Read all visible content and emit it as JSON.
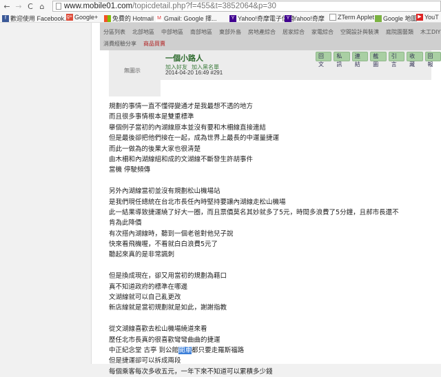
{
  "browser": {
    "url_host": "www.mobile01.com",
    "url_path": "/topicdetail.php?f=455&t=3852064&p=30",
    "bookmarks": [
      "歡迎使用 Facebook...",
      "Google+",
      "免費的 Hotmail",
      "Gmail: Google 擇...",
      "Yahoo!奇摩電子信箱",
      "Yahoo!奇摩",
      "ZTerm Applet",
      "Google 地圖",
      "YouT"
    ]
  },
  "nav": {
    "row1": [
      "分區列表",
      "北部地區",
      "中部地區",
      "南部地區",
      "東部外島",
      "房地產綜合",
      "居家綜合",
      "家電綜合",
      "空間設計與裝潢",
      "庭院園藝類",
      "木工DIY"
    ],
    "row2": [
      "消費經驗分享",
      "商品買賣"
    ]
  },
  "post": {
    "no_image": "無圖示",
    "author": "一個小路人",
    "add_friend": "加入好友",
    "add_block": "加入黑名單",
    "datetime": "2014-04-20 16:49",
    "number": "#291",
    "actions": [
      "回文",
      "私訊",
      "連結",
      "截圖",
      "引言",
      "收藏",
      "回報"
    ],
    "lines": [
      "規劃的事情一直不懂得變通才是我最想不透的地方",
      "而且很多事情根本是雙重標準",
      "舉個例子當初的內湖線原本並沒有要和木柵線直接連結",
      "但是最後卻把他們接在一起，成為世界上最長的中運量捷運",
      "而此一做為的後果大家也很清楚",
      "由木柵和內湖線組和成的文湖線不斷發生許胡事件",
      "當機 停駛頻傳",
      "",
      "另外內湖線當初並沒有規劃松山機場站",
      "是我們現任總統在台北市長任內時堅持要讓內湖線走松山機場",
      "此一結果導致捷運繞了好大一圈，而且票價莫名其妙就多了5元，時間多浪費了5分鐘，且郝市長還不",
      "肯為此降價",
      "有次搭內湖線時，聽到一個老爸對他兒子說",
      "快來看飛機喔，不看就白白浪費5元了",
      "聽起來真的是非常諷刺",
      "",
      "但是換成現在，卻又用當初的規劃為藉口",
      "真不知道政府的標準在哪邊",
      "文湖線就可以自己亂更改",
      "新店線就是當初規劃就是如此，謝謝指教",
      "",
      "從文湖線喜歡去松山機場繞道來看",
      "歷任北市長真的很喜歡彎彎曲曲的捷運"
    ],
    "line_hl": {
      "before": "中正紀念堂 古亭 到公館",
      "selected": "開車",
      "after": "都只要走羅斯福路"
    },
    "lines_end": [
      "但是捷運卻可以拆成兩段",
      "每個乘客每次多收五元，一年下來不知道可以累積多少錢"
    ]
  }
}
